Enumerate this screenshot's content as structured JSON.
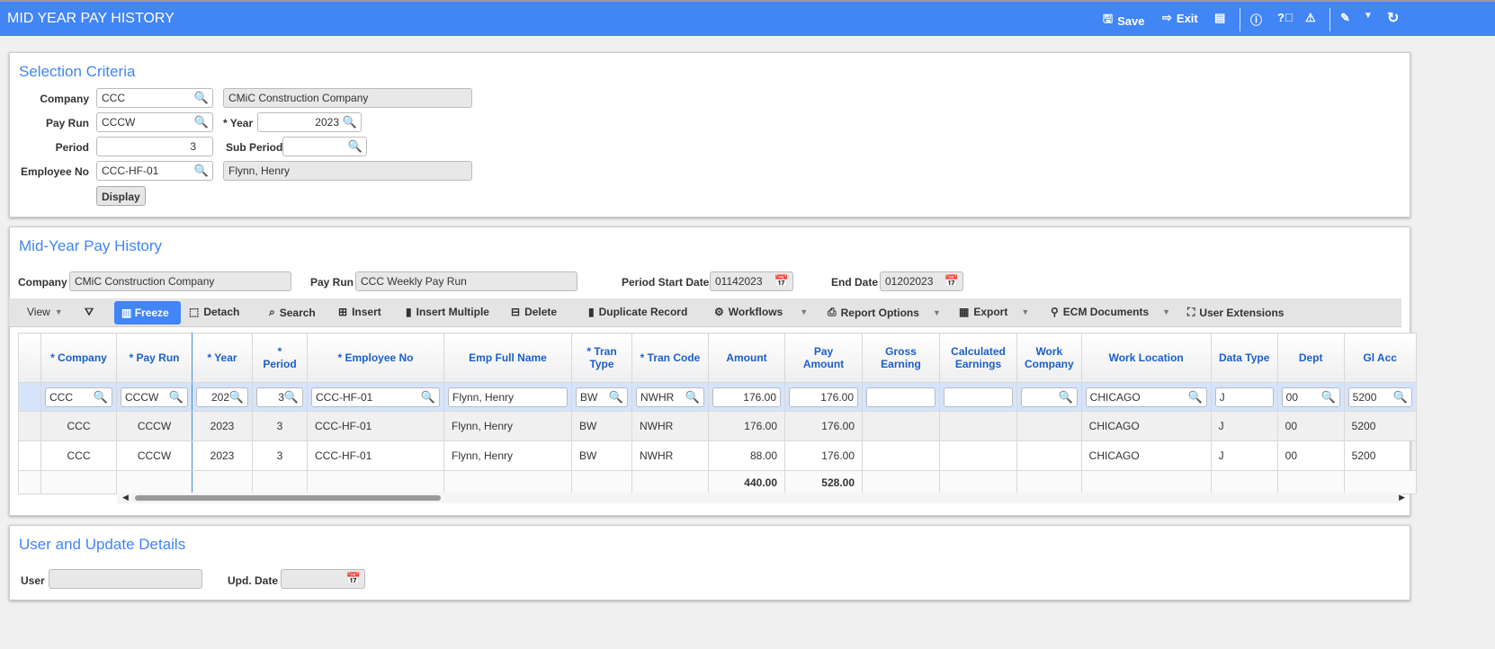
{
  "header": {
    "title": "MID YEAR PAY HISTORY",
    "save": "Save",
    "exit": "Exit",
    "icons": [
      "save-icon",
      "exit-icon",
      "print-icon",
      "info-icon",
      "help-icon",
      "warning-icon",
      "edit-icon",
      "chevron-down-icon",
      "refresh-icon"
    ]
  },
  "selection": {
    "title": "Selection Criteria",
    "company_label": "Company",
    "company": "CCC",
    "company_name": "CMiC Construction Company",
    "payrun_label": "Pay Run",
    "payrun": "CCCW",
    "year_label": "* Year",
    "year": "2023",
    "period_label": "Period",
    "period": "3",
    "subperiod_label": "Sub Period",
    "subperiod": "",
    "employee_label": "Employee No",
    "employee": "CCC-HF-01",
    "employee_name": "Flynn, Henry",
    "display": "Display"
  },
  "history": {
    "title": "Mid-Year Pay History",
    "company_label": "Company",
    "company": "CMiC Construction Company",
    "payrun_label": "Pay Run",
    "payrun": "CCC Weekly Pay Run",
    "start_label": "Period Start Date",
    "start": "01142023",
    "end_label": "End Date",
    "end": "01202023"
  },
  "toolbar": {
    "view": "View",
    "freeze": "Freeze",
    "detach": "Detach",
    "search": "Search",
    "insert": "Insert",
    "insert_multiple": "Insert Multiple",
    "delete": "Delete",
    "duplicate": "Duplicate Record",
    "workflows": "Workflows",
    "report": "Report Options",
    "export": "Export",
    "ecm": "ECM Documents",
    "extensions": "User Extensions"
  },
  "grid": {
    "columns": [
      "* Company",
      "* Pay Run",
      "* Year",
      "* Period",
      "* Employee No",
      "Emp Full Name",
      "* Tran Type",
      "* Tran Code",
      "Amount",
      "Pay Amount",
      "Gross Earning",
      "Calculated Earnings",
      "Work Company",
      "Work Location",
      "Data Type",
      "Dept",
      "Gl Acc"
    ],
    "filter": [
      "CCC",
      "CCCW",
      "202",
      "3",
      "CCC-HF-01",
      "Flynn, Henry",
      "BW",
      "NWHR",
      "176.00",
      "176.00",
      "",
      "",
      "",
      "CHICAGO",
      "J",
      "00",
      "5200"
    ],
    "rows": [
      [
        "CCC",
        "CCCW",
        "2023",
        "3",
        "CCC-HF-01",
        "Flynn, Henry",
        "BW",
        "NWHR",
        "176.00",
        "176.00",
        "",
        "",
        "",
        "CHICAGO",
        "J",
        "00",
        "5200"
      ],
      [
        "CCC",
        "CCCW",
        "2023",
        "3",
        "CCC-HF-01",
        "Flynn, Henry",
        "BW",
        "NWHR",
        "88.00",
        "176.00",
        "",
        "",
        "",
        "CHICAGO",
        "J",
        "00",
        "5200"
      ]
    ],
    "totals": {
      "amount": "440.00",
      "pay_amount": "528.00"
    }
  },
  "user": {
    "title": "User and Update Details",
    "user_label": "User",
    "user": "",
    "date_label": "Upd. Date",
    "date": ""
  }
}
